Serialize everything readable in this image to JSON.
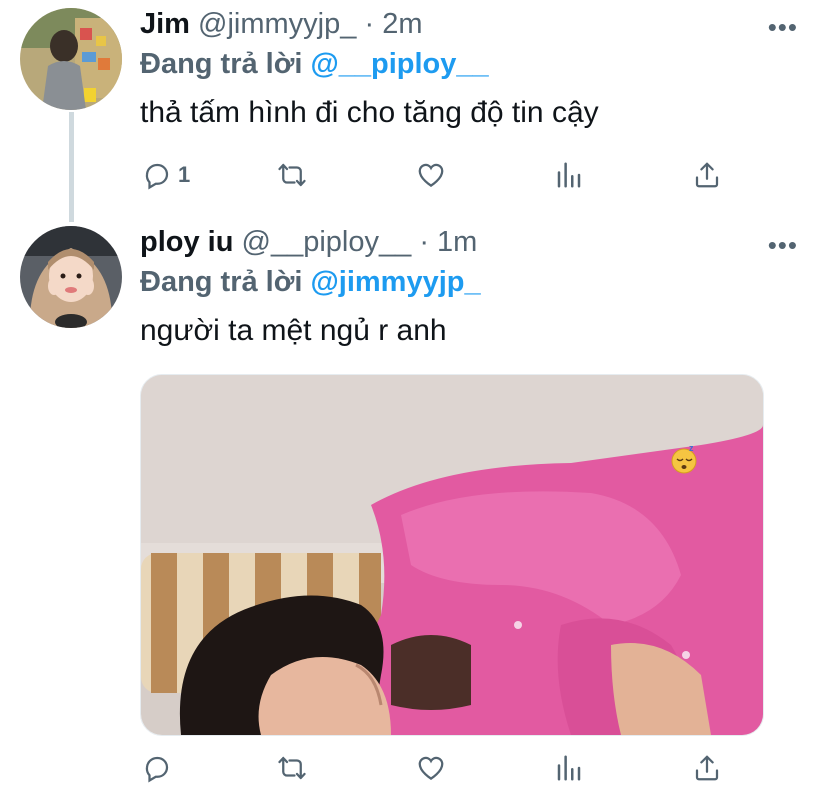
{
  "tweets": [
    {
      "name": "Jim",
      "handle": "@jimmyyjp_",
      "separator": "·",
      "time": "2m",
      "reply_prefix": "Đang trả lời",
      "reply_mention": "@__piploy__",
      "text": "thả tấm hình đi cho tăng độ tin cậy",
      "reply_count": "1",
      "more": "•••"
    },
    {
      "name": "ploy iu",
      "handle": "@__piploy__",
      "separator": "·",
      "time": "1m",
      "reply_prefix": "Đang trả lời",
      "reply_mention": "@jimmyyjp_",
      "text": "người ta mệt ngủ r anh",
      "reply_count": "",
      "more": "•••"
    }
  ],
  "colors": {
    "mention": "#1d9bf0",
    "secondary_text": "#536471",
    "thread_line": "#cfd9de"
  },
  "icons": [
    "reply-icon",
    "retweet-icon",
    "like-icon",
    "analytics-icon",
    "share-icon",
    "more-icon",
    "sleeping-emoji"
  ]
}
